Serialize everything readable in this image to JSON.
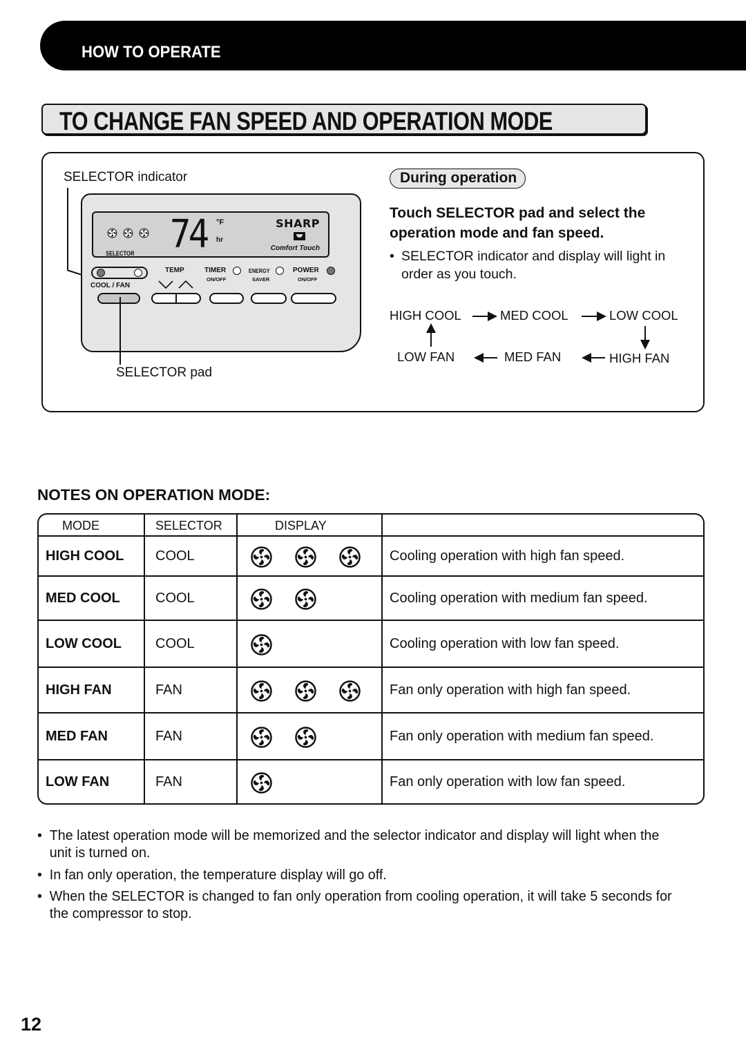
{
  "section_banner": "HOW TO OPERATE",
  "title": "TO CHANGE FAN SPEED AND OPERATION MODE",
  "panel": {
    "selector_indicator_label": "SELECTOR indicator",
    "selector_pad_label": "SELECTOR pad",
    "remote": {
      "lcd_fan_icons": [
        "fan-icon",
        "fan-icon",
        "fan-icon"
      ],
      "temperature": "74",
      "unit_f": "°F",
      "unit_hr": "hr",
      "brand": "SHARP",
      "tagline": "Comfort Touch",
      "selector_label": "SELECTOR",
      "cool_fan_label": "COOL / FAN",
      "temp_label": "TEMP",
      "temp_down_icon": "chevron-down-icon",
      "temp_up_icon": "chevron-up-icon",
      "timer_label": "TIMER",
      "timer_sub": "ON/OFF",
      "energy_label": "ENERGY",
      "energy_sub": "SAVER",
      "power_label": "POWER",
      "power_sub": "ON/OFF"
    },
    "during_label": "During operation",
    "instruction_heading": "Touch SELECTOR pad and select the operation mode and fan speed.",
    "instruction_bullet": "SELECTOR indicator and display will light in order as you touch.",
    "cycle": {
      "high_cool": "HIGH COOL",
      "med_cool": "MED COOL",
      "low_cool": "LOW COOL",
      "high_fan": "HIGH FAN",
      "med_fan": "MED FAN",
      "low_fan": "LOW FAN"
    }
  },
  "notes": {
    "heading": "NOTES ON OPERATION MODE:",
    "columns": [
      "MODE",
      "SELECTOR",
      "DISPLAY",
      ""
    ],
    "rows": [
      {
        "mode": "HIGH COOL",
        "selector": "COOL",
        "fan_count": 3,
        "description": "Cooling operation with high fan speed."
      },
      {
        "mode": "MED COOL",
        "selector": "COOL",
        "fan_count": 2,
        "description": "Cooling operation with medium fan speed."
      },
      {
        "mode": "LOW COOL",
        "selector": "COOL",
        "fan_count": 1,
        "description": "Cooling operation with low fan speed."
      },
      {
        "mode": "HIGH FAN",
        "selector": "FAN",
        "fan_count": 3,
        "description": "Fan only operation with high fan speed."
      },
      {
        "mode": "MED FAN",
        "selector": "FAN",
        "fan_count": 2,
        "description": "Fan only operation with medium fan speed."
      },
      {
        "mode": "LOW FAN",
        "selector": "FAN",
        "fan_count": 1,
        "description": "Fan only operation with low fan speed."
      }
    ],
    "bullets": [
      "The latest operation mode will be memorized and the selector indicator and display will light when the unit is turned on.",
      "In fan only operation, the temperature display will go off.",
      "When the SELECTOR is changed to fan only operation from cooling  operation, it will take 5 seconds for the compressor to stop."
    ]
  },
  "bullet_char": "•",
  "page_number": "12"
}
